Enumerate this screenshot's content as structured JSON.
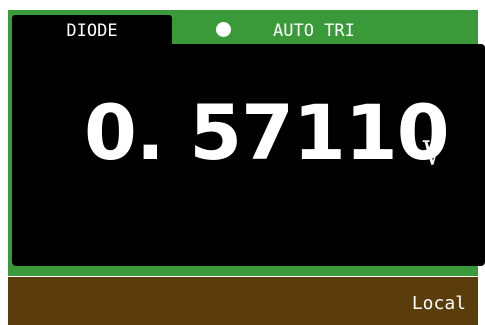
{
  "header": {
    "mode_tab": "DIODE",
    "trigger_indicator": "circle-filled-icon",
    "trigger_mode": "AUTO TRI"
  },
  "display": {
    "value": "0. 57110",
    "unit": "V"
  },
  "status_bar": {
    "remote_state": "Local"
  },
  "colors": {
    "frame_green": "#3a9a3a",
    "display_bg": "#000000",
    "status_bar_bg": "#5a3d0a",
    "text": "#ffffff"
  }
}
